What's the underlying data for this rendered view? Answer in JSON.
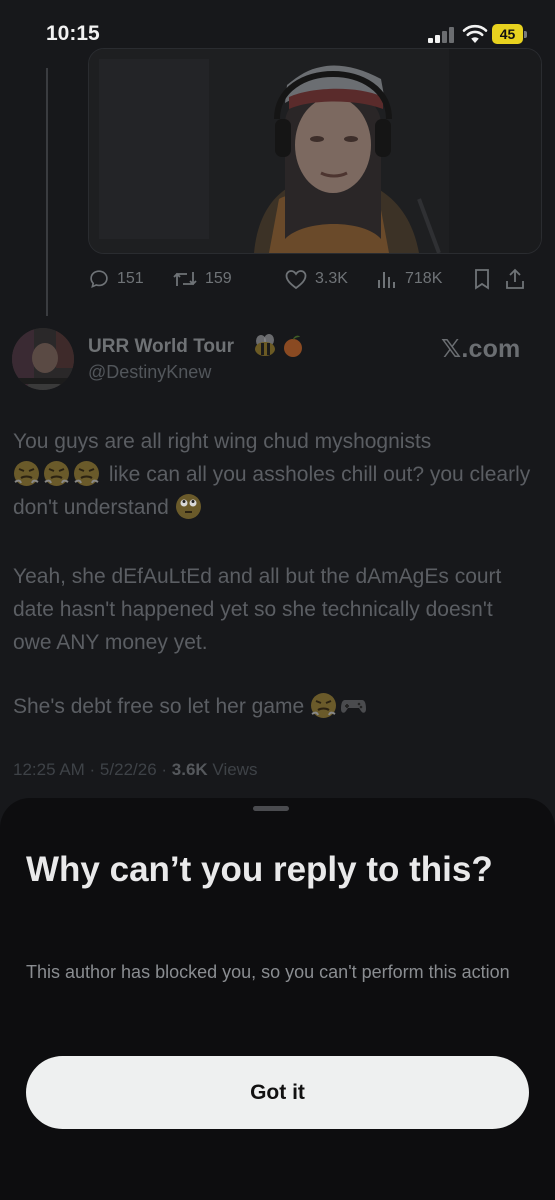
{
  "status_bar": {
    "time": "10:15",
    "battery": "45"
  },
  "previous_tweet": {
    "actions": {
      "replies": "151",
      "reposts": "159",
      "likes": "3.3K",
      "views": "718K"
    }
  },
  "tweet": {
    "display_name": "URR World Tour",
    "handle": "@DestinyKnew",
    "watermark": "𝕏.com",
    "paragraph1_a": "You guys are all right wing chud myshognists",
    "paragraph1_b": "like can all you assholes chill out? you clearly don't understand",
    "paragraph2": "Yeah, she dEfAuLtEd and all but the dAmAgEs court date hasn't happened yet so she technically doesn't owe ANY money yet.",
    "paragraph3": "She's debt free so let her game",
    "time_date": "12:25 AM · 5/22/26 · ",
    "views_count": "3.6K",
    "views_label": " Views"
  },
  "sheet": {
    "title": "Why can’t you reply to this?",
    "description": "This author has blocked you, so you can't perform this action",
    "button_label": "Got it"
  },
  "colors": {
    "background": "#17181b",
    "sheet": "#0d0d0f",
    "button": "#eef0f0",
    "battery": "#e8d21f"
  }
}
